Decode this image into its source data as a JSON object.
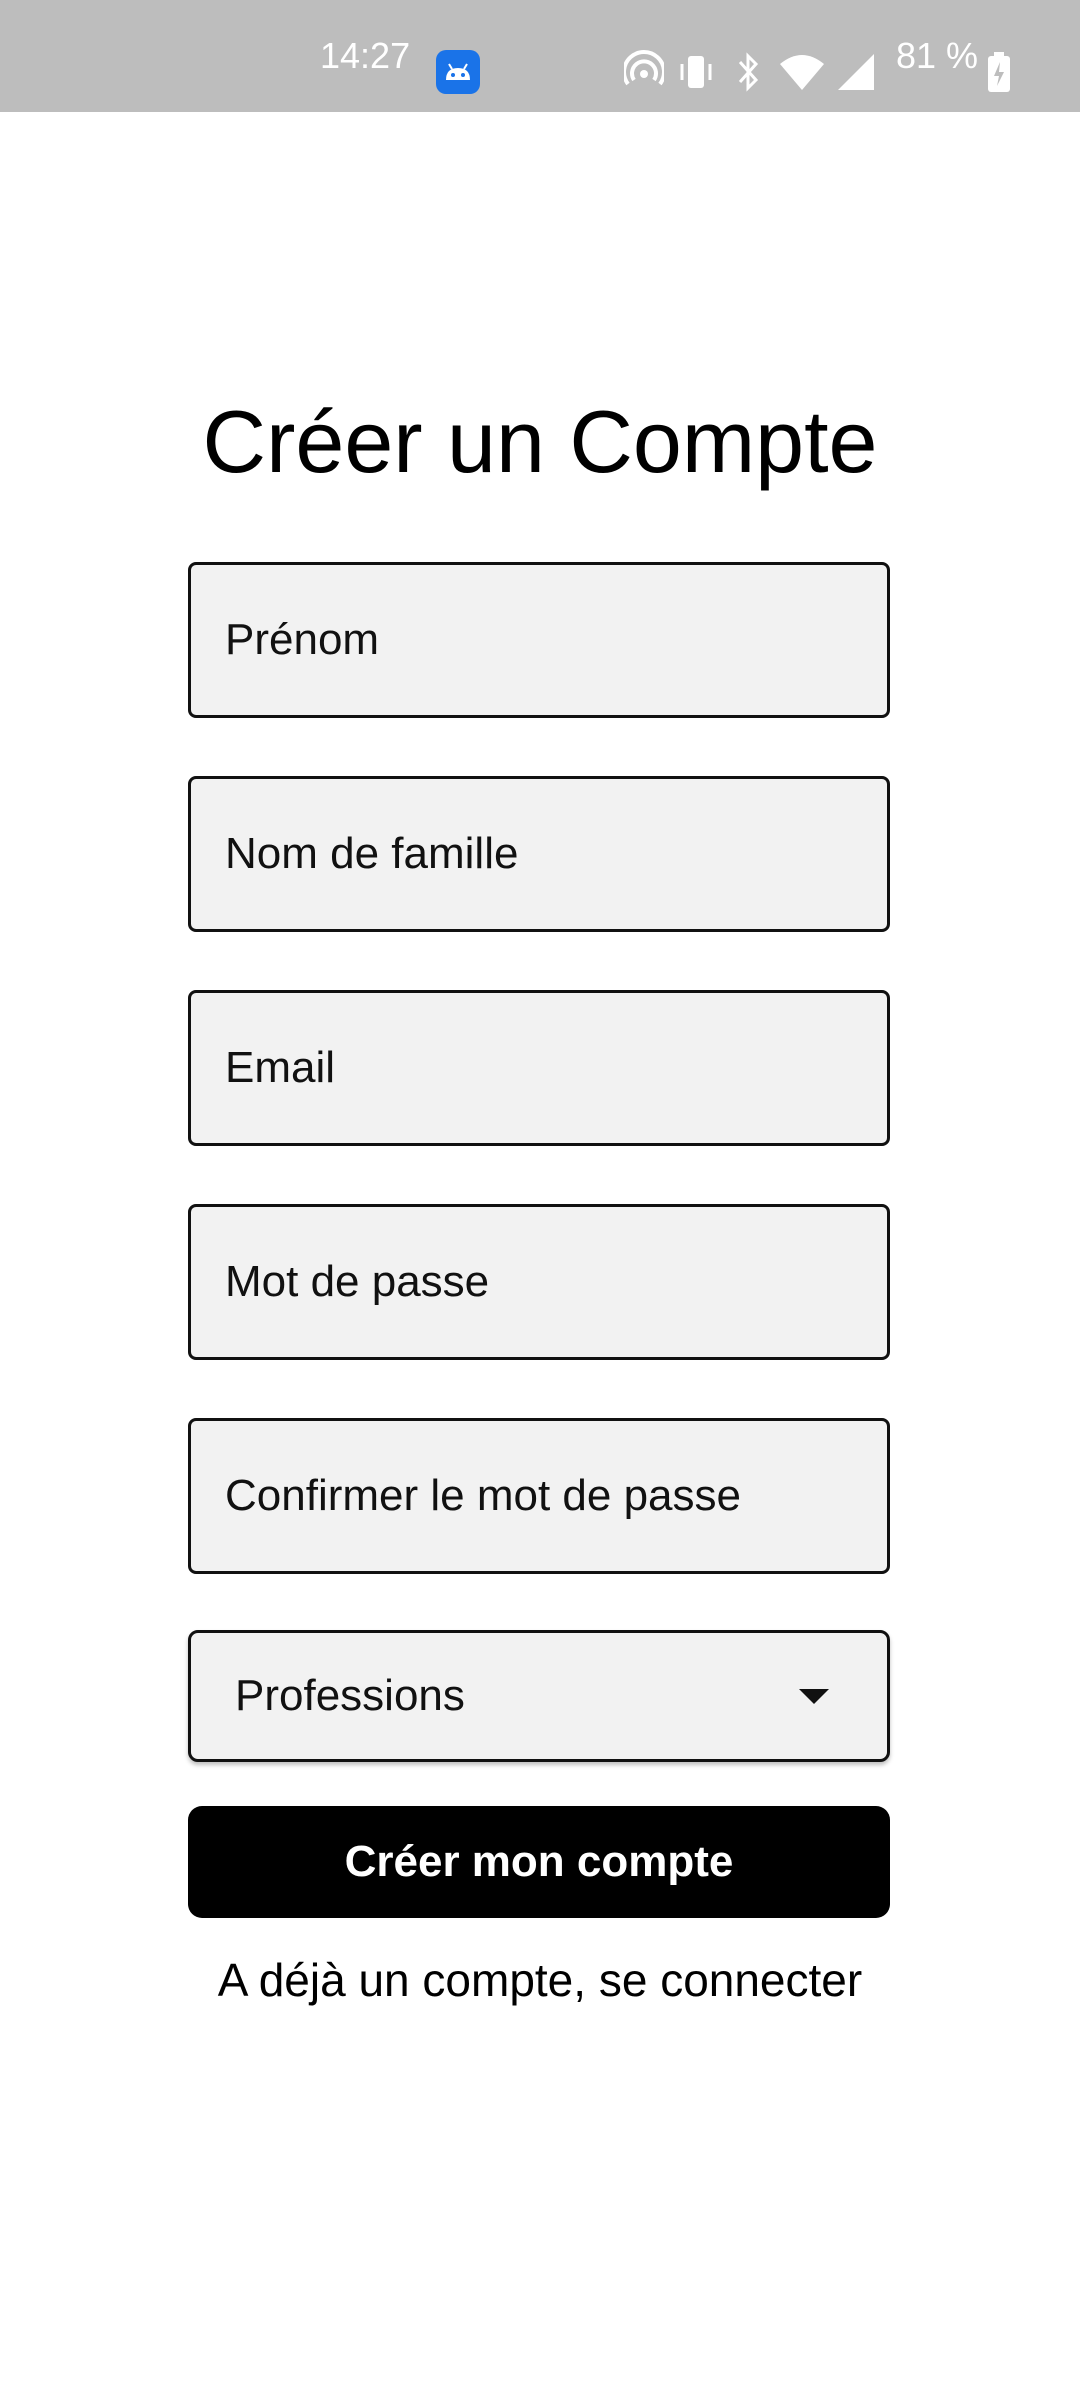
{
  "status_bar": {
    "time": "14:27",
    "battery": "81 %",
    "icons": [
      "android-app-icon",
      "hotspot-icon",
      "vibrate-icon",
      "bluetooth-icon",
      "wifi-icon",
      "signal-icon",
      "battery-icon"
    ]
  },
  "form": {
    "title": "Créer un Compte",
    "fields": {
      "first_name": {
        "placeholder": "Prénom",
        "value": ""
      },
      "last_name": {
        "placeholder": "Nom de famille",
        "value": ""
      },
      "email": {
        "placeholder": "Email",
        "value": ""
      },
      "password": {
        "placeholder": "Mot de passe",
        "value": ""
      },
      "confirm_password": {
        "placeholder": "Confirmer le mot de passe",
        "value": ""
      }
    },
    "profession_select": {
      "label": "Professions"
    },
    "submit_label": "Créer mon compte",
    "signin_link": "A déjà un compte, se connecter"
  },
  "colors": {
    "status_bar_bg": "#bdbdbd",
    "field_bg": "#f2f2f2",
    "button_bg": "#000000",
    "app_icon": "#1a73e8"
  }
}
